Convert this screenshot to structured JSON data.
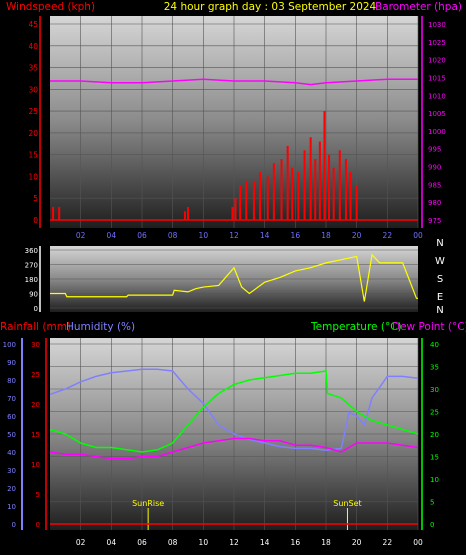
{
  "colors": {
    "windspeed": "#ff0000",
    "gust": "#ffff00",
    "avgwind": "#00ff00",
    "barometer": "#ff00ff",
    "direction": "#ffff00",
    "rainfall": "#ff0000",
    "humidity": "#8080ff",
    "temperature": "#00ff00",
    "dewpoint": "#ff00ff",
    "sun": "#ffff00",
    "time_axis": "#5050ff"
  },
  "chart_data": [
    {
      "type": "line",
      "title": "24 hour graph day : 03 September 2024",
      "ylabel": "Windspeed (kph)",
      "y2label": "Barometer (hpa)",
      "x_tick_labels": [
        "02",
        "04",
        "06",
        "08",
        "10",
        "12",
        "14",
        "16",
        "18",
        "20",
        "22",
        "00"
      ],
      "ylim": [
        0,
        45
      ],
      "y_ticks": [
        0,
        5,
        10,
        15,
        20,
        25,
        30,
        35,
        40,
        45
      ],
      "y2lim": [
        975,
        1030
      ],
      "y2_ticks": [
        975,
        980,
        985,
        990,
        995,
        1000,
        1005,
        1010,
        1015,
        1020,
        1025,
        1030
      ],
      "grid": true,
      "series": [
        {
          "name": "Windspeed (kph)",
          "axis": "left",
          "style": "bars",
          "x": [
            0.2,
            0.6,
            8.8,
            9.0,
            11.9,
            12.1,
            12.4,
            12.8,
            13.3,
            13.7,
            14.2,
            14.6,
            15.1,
            15.5,
            15.8,
            16.2,
            16.6,
            17.0,
            17.3,
            17.6,
            17.9,
            18.2,
            18.5,
            18.9,
            19.3,
            19.6,
            20.0
          ],
          "values": [
            3,
            3,
            2,
            3,
            3,
            5,
            8,
            9,
            9,
            11,
            10,
            13,
            14,
            17,
            12,
            11,
            16,
            19,
            14,
            18,
            25,
            15,
            12,
            16,
            14,
            11,
            8
          ]
        },
        {
          "name": "Barometer (hpa)",
          "axis": "right",
          "style": "line",
          "x": [
            0,
            2,
            4,
            6,
            8,
            10,
            12,
            14,
            16,
            17,
            18,
            20,
            22,
            24
          ],
          "values": [
            1014,
            1014,
            1013.5,
            1013.5,
            1014,
            1014.5,
            1014,
            1014,
            1013.5,
            1013,
            1013.5,
            1014,
            1014.5,
            1014.5
          ]
        }
      ]
    },
    {
      "type": "line",
      "ylim": [
        0,
        360
      ],
      "y_ticks": [
        0,
        90,
        180,
        270,
        360
      ],
      "y2_tick_labels": [
        "N",
        "W",
        "S",
        "E",
        "N"
      ],
      "series": [
        {
          "name": "Wind direction",
          "x": [
            0,
            1,
            1.1,
            5,
            5.1,
            8,
            8.1,
            9,
            9.5,
            10,
            11,
            12,
            12.5,
            13,
            14,
            15,
            16,
            17,
            18,
            19,
            20,
            20.5,
            21,
            21.5,
            22,
            23,
            23.9,
            24
          ],
          "values": [
            90,
            90,
            70,
            70,
            80,
            80,
            110,
            100,
            120,
            130,
            140,
            250,
            130,
            90,
            160,
            190,
            230,
            250,
            280,
            300,
            320,
            40,
            330,
            280,
            280,
            280,
            60,
            60
          ]
        }
      ]
    },
    {
      "type": "line",
      "ylabel": "Rainfall (mm)",
      "ylabel2": "Humidity (%)",
      "y2label": "Temperature (°C)",
      "y2label2": "Dew Point (°C)",
      "annotations": [
        "SunRise",
        "SunSet"
      ],
      "sunrise_x": 6.4,
      "sunset_x": 19.4,
      "rain_ylim": [
        0,
        30
      ],
      "rain_ticks": [
        0,
        5,
        10,
        15,
        20,
        25,
        30
      ],
      "humidity_ylim": [
        0,
        100
      ],
      "humidity_ticks": [
        0,
        10,
        20,
        30,
        40,
        50,
        60,
        70,
        80,
        90,
        100
      ],
      "temp_ylim": [
        0,
        40
      ],
      "temp_ticks": [
        0,
        5,
        10,
        15,
        20,
        25,
        30,
        35,
        40
      ],
      "grid": true,
      "series": [
        {
          "name": "Humidity (%)",
          "axis": "humidity",
          "x": [
            0,
            1,
            2,
            3,
            4,
            5,
            6,
            7,
            8,
            9,
            10,
            11,
            12,
            13,
            14,
            15,
            16,
            17,
            18,
            19,
            19.5,
            20,
            20.5,
            21,
            22,
            23,
            24
          ],
          "values": [
            72,
            75,
            79,
            82,
            84,
            85,
            86,
            86,
            85,
            75,
            67,
            55,
            50,
            47,
            45,
            43,
            42,
            42,
            41,
            42,
            62,
            60,
            55,
            70,
            82,
            82,
            81
          ]
        },
        {
          "name": "Temperature (°C)",
          "axis": "temp",
          "x": [
            0,
            1,
            2,
            3,
            4,
            5,
            6,
            7,
            8,
            9,
            10,
            11,
            12,
            13,
            14,
            15,
            16,
            17,
            18,
            18.1,
            19,
            20,
            21,
            22,
            23,
            24
          ],
          "values": [
            21,
            20,
            18,
            17,
            17,
            16.5,
            16,
            16.5,
            18,
            22,
            26,
            29,
            31,
            32,
            32.5,
            33,
            33.5,
            33.5,
            34,
            29,
            28,
            25,
            23,
            22,
            21,
            20
          ]
        },
        {
          "name": "Dew Point (°C)",
          "axis": "temp",
          "x": [
            0,
            1,
            2,
            3,
            4,
            5,
            6,
            7,
            8,
            9,
            10,
            11,
            12,
            13,
            14,
            15,
            16,
            17,
            18,
            19,
            20,
            21,
            22,
            23,
            24
          ],
          "values": [
            16,
            15.5,
            15.5,
            15,
            14.5,
            14.5,
            15,
            15,
            16,
            17,
            18,
            18.5,
            19,
            19,
            18.5,
            18.5,
            17.5,
            17.5,
            17,
            16,
            18,
            18,
            18,
            17.5,
            17
          ]
        },
        {
          "name": "Rainfall (mm)",
          "axis": "rain",
          "x": [
            0,
            24
          ],
          "values": [
            0,
            0
          ]
        }
      ]
    }
  ]
}
